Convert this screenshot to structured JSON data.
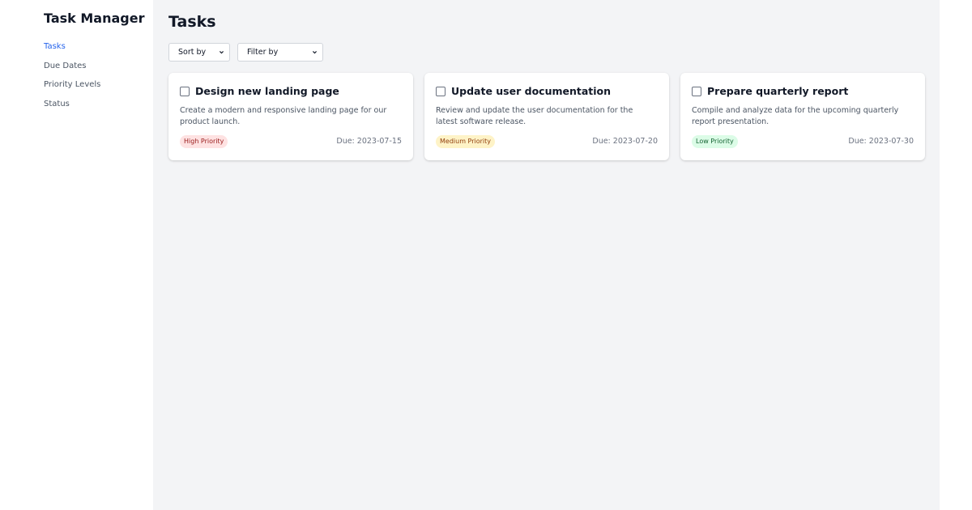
{
  "app": {
    "title": "Task Manager"
  },
  "sidebar": {
    "items": [
      {
        "label": "Tasks",
        "active": true
      },
      {
        "label": "Due Dates",
        "active": false
      },
      {
        "label": "Priority Levels",
        "active": false
      },
      {
        "label": "Status",
        "active": false
      }
    ]
  },
  "main": {
    "title": "Tasks",
    "sort": {
      "selected": "Sort by",
      "icon": "chevron-down-icon"
    },
    "filter": {
      "selected": "Filter by",
      "icon": "chevron-down-icon"
    },
    "tasks": [
      {
        "title": "Design new landing page",
        "description": "Create a modern and responsive landing page for our product launch.",
        "priority": "High Priority",
        "priority_level": "high",
        "due": "Due: 2023-07-15",
        "checked": false
      },
      {
        "title": "Update user documentation",
        "description": "Review and update the user documentation for the latest software release.",
        "priority": "Medium Priority",
        "priority_level": "medium",
        "due": "Due: 2023-07-20",
        "checked": false
      },
      {
        "title": "Prepare quarterly report",
        "description": "Compile and analyze data for the upcoming quarterly report presentation.",
        "priority": "Low Priority",
        "priority_level": "low",
        "due": "Due: 2023-07-30",
        "checked": false
      }
    ]
  },
  "colors": {
    "accent": "#2563eb",
    "main_background": "#f3f4f6",
    "high_badge": "#fee2e2",
    "medium_badge": "#fef3c7",
    "low_badge": "#dcfce7"
  }
}
